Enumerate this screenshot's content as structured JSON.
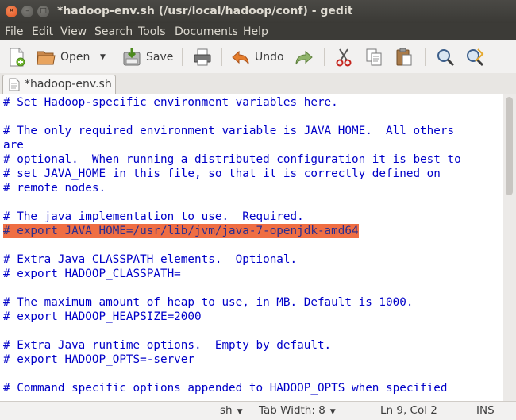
{
  "window": {
    "title": "*hadoop-env.sh (/usr/local/hadoop/conf) - gedit"
  },
  "menu": [
    "File",
    "Edit",
    "View",
    "Search",
    "Tools",
    "Documents",
    "Help"
  ],
  "toolbar": {
    "open_label": "Open",
    "save_label": "Save",
    "undo_label": "Undo"
  },
  "tab": {
    "label": "*hadoop-env.sh"
  },
  "editor": {
    "lines": [
      "# Set Hadoop-specific environment variables here.",
      "",
      "# The only required environment variable is JAVA_HOME.  All others",
      "are",
      "# optional.  When running a distributed configuration it is best to",
      "# set JAVA_HOME in this file, so that it is correctly defined on",
      "# remote nodes.",
      "",
      "# The java implementation to use.  Required.",
      "# export JAVA_HOME=/usr/lib/jvm/java-7-openjdk-amd64",
      "",
      "# Extra Java CLASSPATH elements.  Optional.",
      "# export HADOOP_CLASSPATH=",
      "",
      "# The maximum amount of heap to use, in MB. Default is 1000.",
      "# export HADOOP_HEAPSIZE=2000",
      "",
      "# Extra Java runtime options.  Empty by default.",
      "# export HADOOP_OPTS=-server",
      "",
      "# Command specific options appended to HADOOP_OPTS when specified"
    ],
    "selected_line": 9
  },
  "status": {
    "language": "sh",
    "tab_width": "Tab Width: 8",
    "position": "Ln 9, Col 2",
    "mode": "INS"
  },
  "colors": {
    "comment": "#0000c8",
    "selection": "#ef6e43",
    "titlebar": "#3c3b37"
  }
}
